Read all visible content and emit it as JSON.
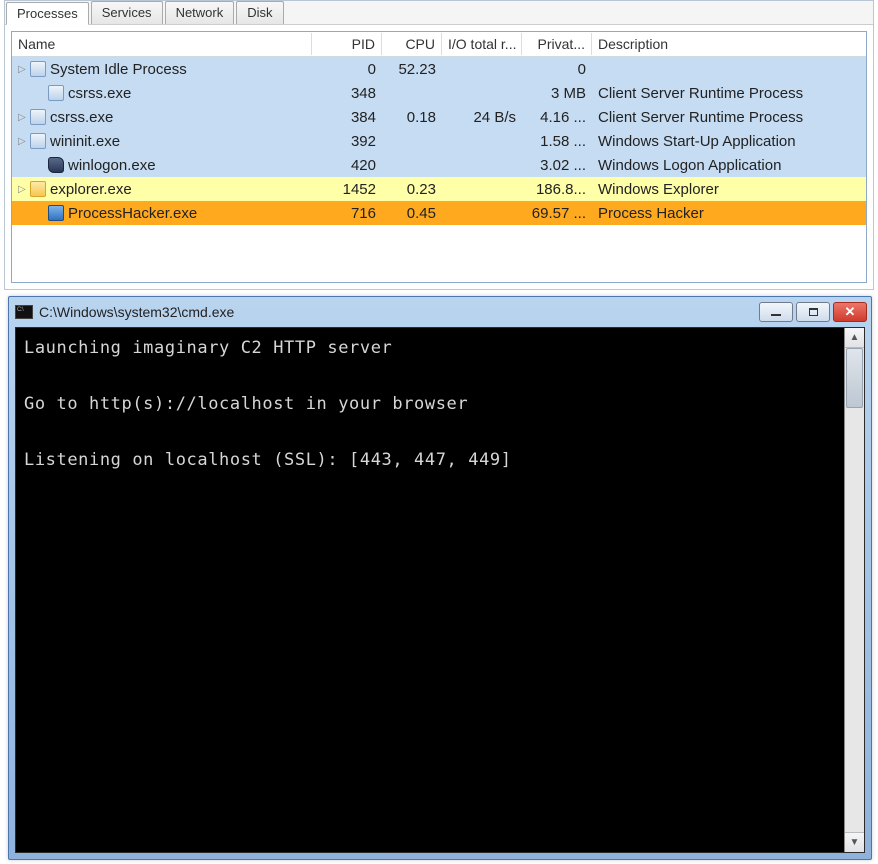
{
  "process_hacker": {
    "tabs": [
      "Processes",
      "Services",
      "Network",
      "Disk"
    ],
    "active_tab": 0,
    "columns": {
      "name": "Name",
      "pid": "PID",
      "cpu": "CPU",
      "io": "I/O total r...",
      "private": "Privat...",
      "desc": "Description"
    },
    "rows": [
      {
        "indent": 0,
        "expand": true,
        "icon": "exe",
        "name": "System Idle Process",
        "pid": "0",
        "cpu": "52.23",
        "io": "",
        "private": "0",
        "desc": "",
        "style": "blue"
      },
      {
        "indent": 1,
        "expand": false,
        "icon": "exe",
        "name": "csrss.exe",
        "pid": "348",
        "cpu": "",
        "io": "",
        "private": "3 MB",
        "desc": "Client Server Runtime Process",
        "style": "blue"
      },
      {
        "indent": 0,
        "expand": true,
        "icon": "exe",
        "name": "csrss.exe",
        "pid": "384",
        "cpu": "0.18",
        "io": "24 B/s",
        "private": "4.16 ...",
        "desc": "Client Server Runtime Process",
        "style": "blue"
      },
      {
        "indent": 0,
        "expand": true,
        "icon": "exe",
        "name": "wininit.exe",
        "pid": "392",
        "cpu": "",
        "io": "",
        "private": "1.58 ...",
        "desc": "Windows Start-Up Application",
        "style": "blue"
      },
      {
        "indent": 1,
        "expand": false,
        "icon": "shield",
        "name": "winlogon.exe",
        "pid": "420",
        "cpu": "",
        "io": "",
        "private": "3.02 ...",
        "desc": "Windows Logon Application",
        "style": "blue"
      },
      {
        "indent": 0,
        "expand": true,
        "icon": "folder",
        "name": "explorer.exe",
        "pid": "1452",
        "cpu": "0.23",
        "io": "",
        "private": "186.8...",
        "desc": "Windows Explorer",
        "style": "yellow"
      },
      {
        "indent": 1,
        "expand": false,
        "icon": "hacker",
        "name": "ProcessHacker.exe",
        "pid": "716",
        "cpu": "0.45",
        "io": "",
        "private": "69.57 ...",
        "desc": "Process Hacker",
        "style": "orange"
      }
    ]
  },
  "cmd": {
    "title": "C:\\Windows\\system32\\cmd.exe",
    "lines": [
      "Launching imaginary C2 HTTP server",
      "",
      "Go to http(s)://localhost in your browser",
      "",
      "Listening on localhost (SSL): [443, 447, 449]"
    ]
  }
}
